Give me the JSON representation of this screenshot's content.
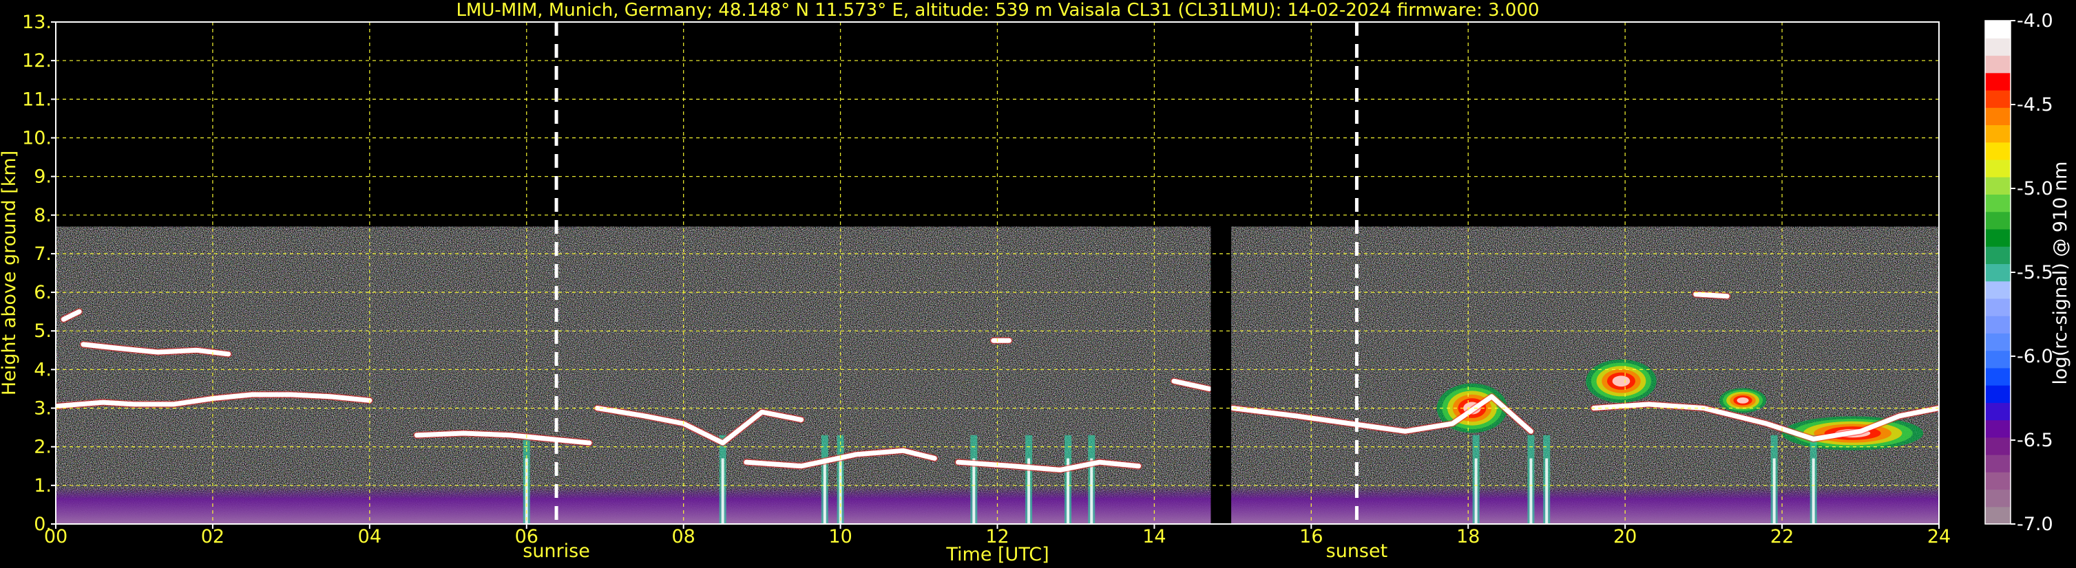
{
  "chart_data": {
    "type": "heatmap",
    "title": "LMU-MIM, Munich, Germany; 48.148° N 11.573° E, altitude: 539 m    Vaisala CL31 (CL31LMU): 14-02-2024    firmware: 3.000",
    "xlabel": "Time [UTC]",
    "ylabel": "Height above ground [km]",
    "xlim": [
      0,
      24
    ],
    "ylim": [
      0,
      13
    ],
    "x_ticks": [
      0,
      2,
      4,
      6,
      8,
      10,
      12,
      14,
      16,
      18,
      20,
      22,
      24
    ],
    "x_tick_labels": [
      "00",
      "02",
      "04",
      "06",
      "08",
      "10",
      "12",
      "14",
      "16",
      "18",
      "20",
      "22",
      "24"
    ],
    "y_ticks": [
      0,
      1,
      2,
      3,
      4,
      5,
      6,
      7,
      8,
      9,
      10,
      11,
      12,
      13
    ],
    "y_tick_labels": [
      "0.",
      "1.",
      "2.",
      "3.",
      "4.",
      "5.",
      "6.",
      "7.",
      "8.",
      "9.",
      "10.",
      "11.",
      "12.",
      "13."
    ],
    "grid": true,
    "data_top_km": 7.7,
    "data_gap_hours": [
      14.72,
      14.98
    ],
    "markers": [
      {
        "label": "sunrise",
        "time_h": 6.38
      },
      {
        "label": "sunset",
        "time_h": 16.58
      }
    ],
    "colorbar": {
      "label": "log(rc-signal) @ 910 nm",
      "range": [
        -7.0,
        -4.0
      ],
      "ticks": [
        -7.0,
        -6.5,
        -6.0,
        -5.5,
        -5.0,
        -4.5,
        -4.0
      ],
      "tick_labels": [
        "-7.0",
        "-6.5",
        "-6.0",
        "-5.5",
        "-5.0",
        "-4.5",
        "-4.0"
      ],
      "colors": [
        "#a08898",
        "#9c6f94",
        "#9a5a90",
        "#8a3d8c",
        "#7a1f8a",
        "#6a0aa0",
        "#3a10d0",
        "#0020f0",
        "#1050ff",
        "#3a78ff",
        "#5a8cff",
        "#7898ff",
        "#90a8ff",
        "#a8c0ff",
        "#40b8a0",
        "#20a060",
        "#009020",
        "#30b030",
        "#60d040",
        "#a0e040",
        "#e0f020",
        "#ffe000",
        "#ffb000",
        "#ff8000",
        "#ff4000",
        "#ff0000",
        "#f0c0c0",
        "#f0e8e8",
        "#ffffff"
      ]
    },
    "cloud_layers": [
      {
        "t": [
          0.0,
          0.3,
          0.6,
          1.0,
          1.5,
          2.0,
          2.5,
          3.0,
          3.5,
          4.0
        ],
        "h_km": [
          3.05,
          3.1,
          3.15,
          3.1,
          3.1,
          3.25,
          3.35,
          3.35,
          3.3,
          3.2
        ]
      },
      {
        "t": [
          0.35,
          0.8,
          1.3,
          1.8,
          2.2
        ],
        "h_km": [
          4.65,
          4.55,
          4.45,
          4.5,
          4.4
        ]
      },
      {
        "t": [
          0.1,
          0.3
        ],
        "h_km": [
          5.3,
          5.5
        ]
      },
      {
        "t": [
          4.6,
          5.2,
          5.8,
          6.3,
          6.8
        ],
        "h_km": [
          2.3,
          2.35,
          2.3,
          2.2,
          2.1
        ]
      },
      {
        "t": [
          6.9,
          7.5,
          8.0,
          8.5,
          9.0,
          9.5
        ],
        "h_km": [
          3.0,
          2.8,
          2.6,
          2.1,
          2.9,
          2.7
        ]
      },
      {
        "t": [
          8.8,
          9.5,
          10.2,
          10.8,
          11.2
        ],
        "h_km": [
          1.6,
          1.5,
          1.8,
          1.9,
          1.7
        ]
      },
      {
        "t": [
          11.5,
          12.2,
          12.8,
          13.3,
          13.8
        ],
        "h_km": [
          1.6,
          1.5,
          1.4,
          1.6,
          1.5
        ]
      },
      {
        "t": [
          14.25,
          14.7
        ],
        "h_km": [
          3.7,
          3.5
        ]
      },
      {
        "t": [
          15.0,
          15.8,
          16.5,
          17.2,
          17.8,
          18.3,
          18.8
        ],
        "h_km": [
          3.0,
          2.8,
          2.6,
          2.4,
          2.6,
          3.3,
          2.4
        ]
      },
      {
        "t": [
          19.6,
          20.3,
          21.0,
          21.8,
          22.4,
          23.0,
          23.5,
          24.0
        ],
        "h_km": [
          3.0,
          3.1,
          3.0,
          2.6,
          2.2,
          2.4,
          2.8,
          3.0
        ]
      },
      {
        "t": [
          20.9,
          21.3
        ],
        "h_km": [
          5.95,
          5.9
        ]
      },
      {
        "t": [
          11.95,
          12.15
        ],
        "h_km": [
          4.75,
          4.75
        ]
      }
    ],
    "strong_returns": [
      {
        "t": [
          17.6,
          18.5
        ],
        "h_km": [
          2.2,
          3.8
        ]
      },
      {
        "t": [
          19.5,
          20.4
        ],
        "h_km": [
          3.0,
          4.4
        ]
      },
      {
        "t": [
          21.2,
          21.8
        ],
        "h_km": [
          2.8,
          3.6
        ]
      },
      {
        "t": [
          22.0,
          23.8
        ],
        "h_km": [
          1.8,
          2.9
        ]
      }
    ],
    "precip_streaks_h": [
      6.0,
      8.5,
      9.8,
      10.0,
      11.7,
      12.4,
      12.9,
      13.2,
      18.1,
      18.8,
      19.0,
      21.9,
      22.4
    ]
  }
}
